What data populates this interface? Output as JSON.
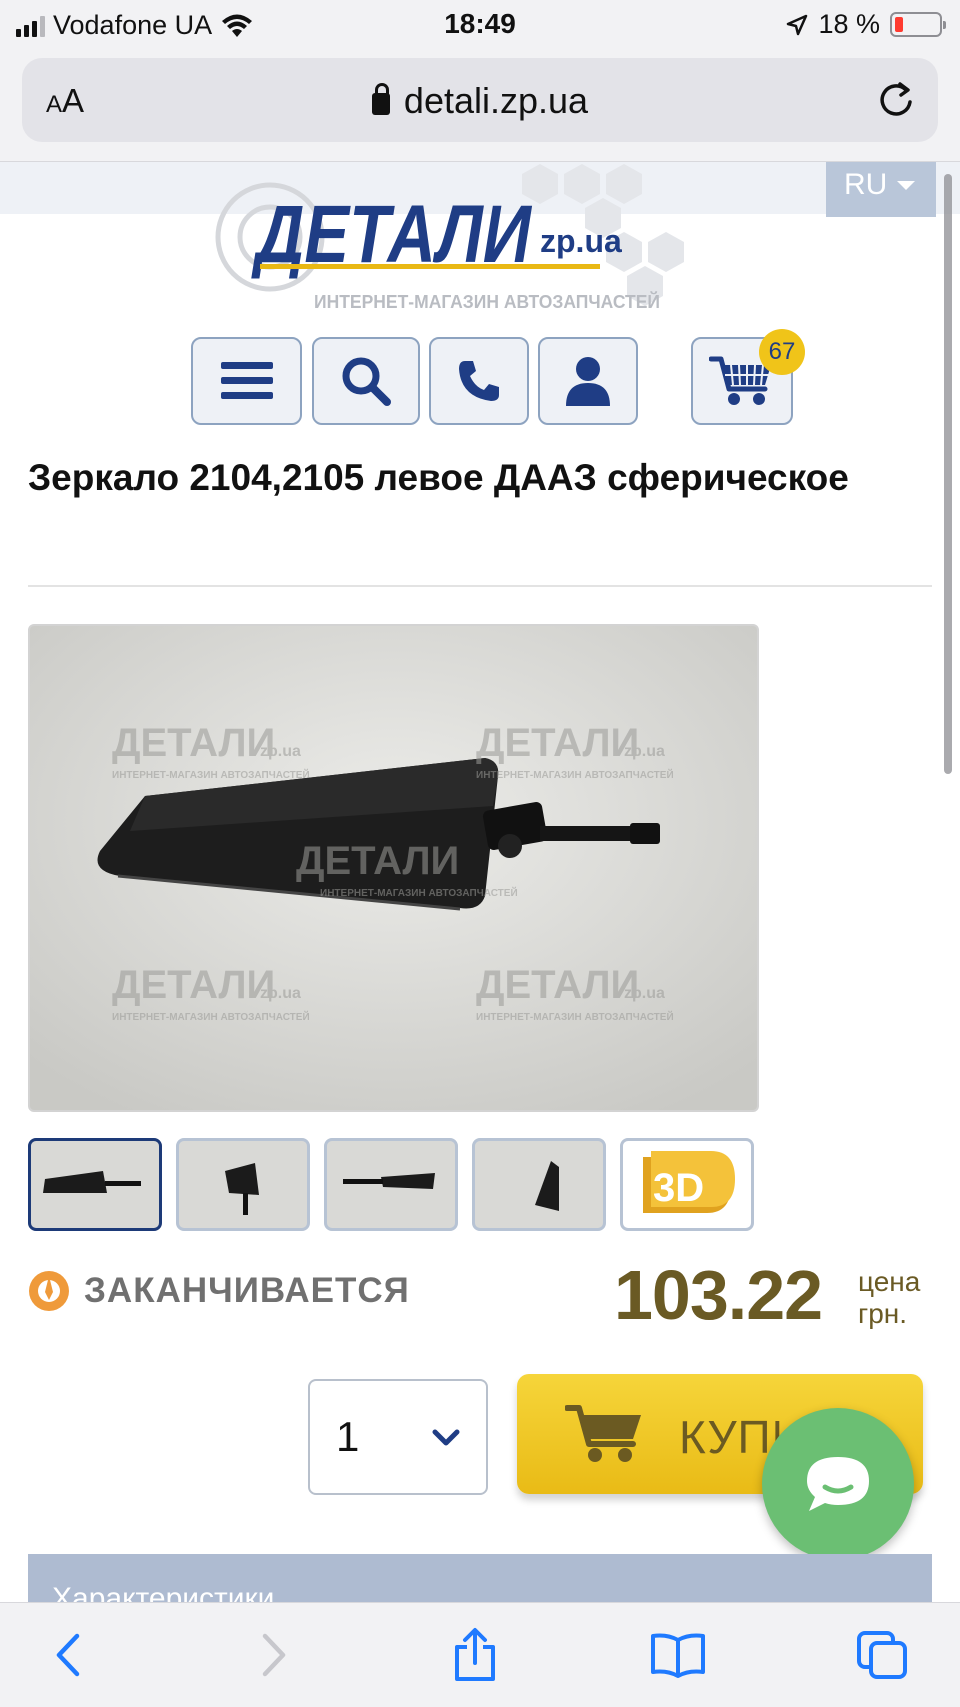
{
  "status_bar": {
    "carrier": "Vodafone UA",
    "time": "18:49",
    "battery": "18 %",
    "battery_level": 0.18
  },
  "browser": {
    "text_size": "AA",
    "url": "detali.zp.ua"
  },
  "site": {
    "language": "RU",
    "logo_text": "ДЕТАЛИ",
    "logo_suffix": "zp.ua",
    "logo_tagline": "ИНТЕРНЕТ-МАГАЗИН АВТОЗАПЧАСТЕЙ",
    "cart_count": "67"
  },
  "product": {
    "title": "Зеркало 2104,2105 левое ДААЗ сферическое",
    "watermark_text": "ДЕТАЛИ",
    "watermark_suffix": "zp.ua",
    "watermark_tagline": "ИНТЕРНЕТ-МАГАЗИН АВТОЗАПЧАСТЕЙ",
    "stock_status": "ЗАКАНЧИВАЕТСЯ",
    "price": "103.22",
    "price_label_1": "цена",
    "price_label_2": "грн.",
    "quantity": "1",
    "buy_label": "КУПИ",
    "thumb_3d_label": "3D"
  },
  "sections": {
    "characteristics": "Характеристики"
  },
  "colors": {
    "brand_blue": "#1d3a78",
    "accent_yellow": "#f0c419",
    "price_color": "#6a5a24",
    "chat_green": "#6bbf73"
  }
}
